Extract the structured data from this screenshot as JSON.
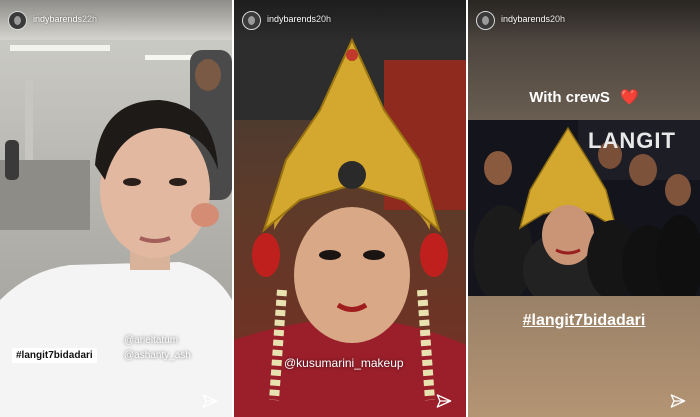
{
  "stories": [
    {
      "username": "indybarends",
      "time": "22h",
      "hashtag": "#langit7bidadari",
      "mentions": [
        "@arieltatum",
        "@ashanty_ash"
      ]
    },
    {
      "username": "indybarends",
      "time": "20h",
      "mention": "@kusumarini_makeup"
    },
    {
      "username": "indybarends",
      "time": "20h",
      "caption": "With crewS",
      "caption_emoji": "❤️",
      "hashtag": "#langit7bidadari",
      "sign_text": "LANGIT"
    }
  ],
  "icons": {
    "send": "paper-plane-icon",
    "avatar": "profile-avatar"
  },
  "colors": {
    "heart": "#e0245e",
    "sticker_bg": "#ffffff"
  }
}
